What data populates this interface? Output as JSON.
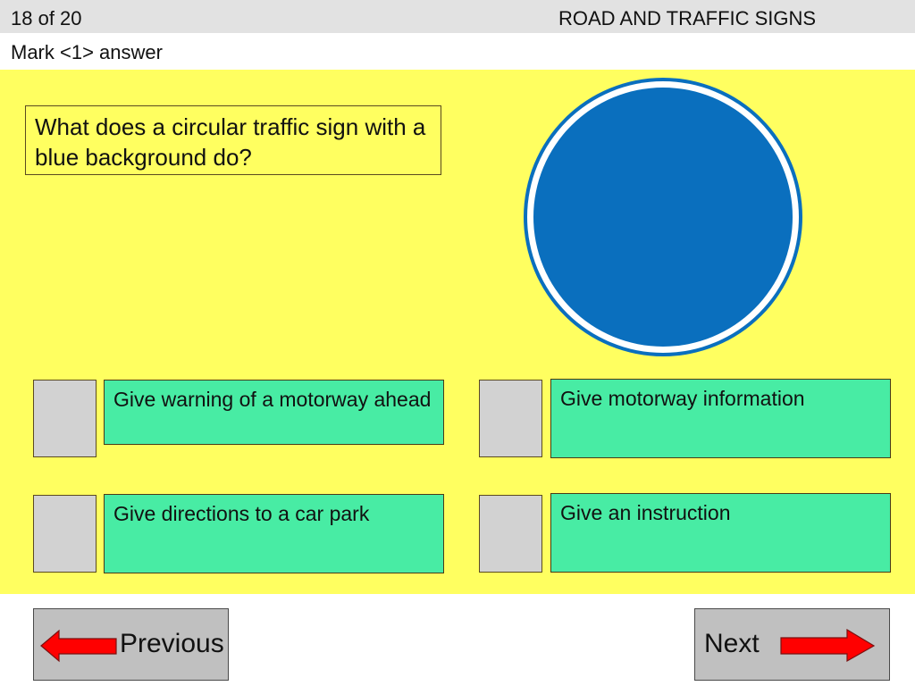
{
  "header": {
    "counter": "18 of 20",
    "section_title": "ROAD AND TRAFFIC SIGNS"
  },
  "instruction": "Mark <1> answer",
  "question": {
    "text": "What does a circular traffic sign with a blue background do?"
  },
  "sign": {
    "icon": "blue-circular-sign",
    "fill_color": "#0a6fbe",
    "ring_color": "#ffffff"
  },
  "options": [
    {
      "label": "Give warning of a motorway ahead",
      "checked": false
    },
    {
      "label": "Give motorway information",
      "checked": false
    },
    {
      "label": "Give directions to a car park",
      "checked": false
    },
    {
      "label": "Give an instruction",
      "checked": false
    }
  ],
  "navigation": {
    "previous_label": "Previous",
    "next_label": "Next",
    "arrow_color": "#ff0000"
  },
  "colors": {
    "stage_background": "#ffff60",
    "option_background": "#48eca4",
    "checkbox_background": "#d2d2d2",
    "header_background": "#e2e2e2"
  }
}
